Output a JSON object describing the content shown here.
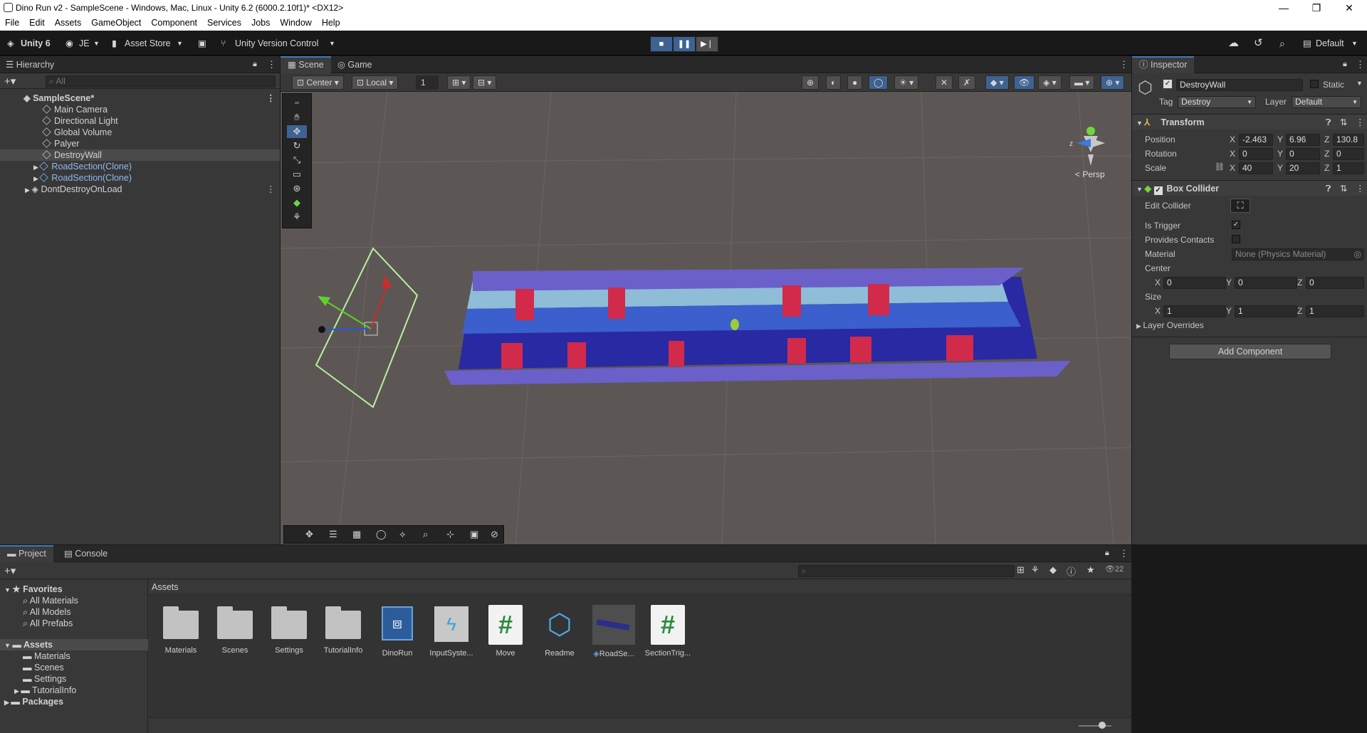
{
  "window": {
    "title": "Dino Run v2 - SampleScene - Windows, Mac, Linux - Unity 6.2 (6000.2.10f1)* <DX12>",
    "minimize": "—",
    "maximize": "❐",
    "close": "✕"
  },
  "menu": [
    "File",
    "Edit",
    "Assets",
    "GameObject",
    "Component",
    "Services",
    "Jobs",
    "Window",
    "Help"
  ],
  "toolbar": {
    "unity_label": "Unity 6",
    "account": "JE",
    "asset_store": "Asset Store",
    "version_control": "Unity Version Control",
    "layout": "Default"
  },
  "hierarchy": {
    "tab": "Hierarchy",
    "search_placeholder": "All",
    "scene": "SampleScene*",
    "items": [
      "Main Camera",
      "Directional Light",
      "Global Volume",
      "Palyer",
      "DestroyWall",
      "RoadSection(Clone)",
      "RoadSection(Clone)"
    ],
    "dont_destroy": "DontDestroyOnLoad"
  },
  "scene_view": {
    "tabs": [
      "Scene",
      "Game"
    ],
    "pivot": "Center",
    "space": "Local",
    "grid_value": "1",
    "persp_label": "< Persp",
    "axis_z": "z"
  },
  "inspector": {
    "tab": "Inspector",
    "object_name": "DestroyWall",
    "static_label": "Static",
    "tag_label": "Tag",
    "tag_value": "Destroy",
    "layer_label": "Layer",
    "layer_value": "Default",
    "transform": {
      "title": "Transform",
      "position_label": "Position",
      "pos_x": "-2.463",
      "pos_y": "6.96",
      "pos_z": "130.8",
      "rotation_label": "Rotation",
      "rot_x": "0",
      "rot_y": "0",
      "rot_z": "0",
      "scale_label": "Scale",
      "scl_x": "40",
      "scl_y": "20",
      "scl_z": "1"
    },
    "box_collider": {
      "title": "Box Collider",
      "edit_collider": "Edit Collider",
      "is_trigger": "Is Trigger",
      "provides_contacts": "Provides Contacts",
      "material_label": "Material",
      "material_value": "None (Physics Material)",
      "center_label": "Center",
      "c_x": "0",
      "c_y": "0",
      "c_z": "0",
      "size_label": "Size",
      "s_x": "1",
      "s_y": "1",
      "s_z": "1",
      "layer_overrides": "Layer Overrides"
    },
    "add_component": "Add Component"
  },
  "project": {
    "tabs": [
      "Project",
      "Console"
    ],
    "favorites": "Favorites",
    "fav_items": [
      "All Materials",
      "All Models",
      "All Prefabs"
    ],
    "assets_root": "Assets",
    "asset_folders": [
      "Materials",
      "Scenes",
      "Settings",
      "TutorialInfo"
    ],
    "packages": "Packages",
    "breadcrumb": "Assets",
    "hidden_count": "22",
    "assets": [
      "Materials",
      "Scenes",
      "Settings",
      "TutorialInfo",
      "DinoRun",
      "InputSyste...",
      "Move",
      "Readme",
      "RoadSe...",
      "SectionTrig..."
    ]
  }
}
